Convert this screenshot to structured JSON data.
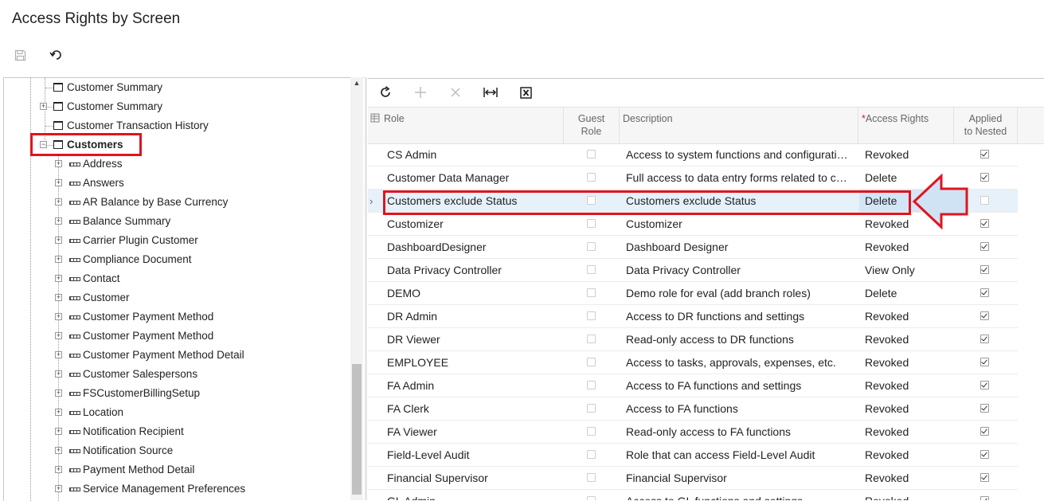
{
  "page": {
    "title": "Access Rights by Screen"
  },
  "toolbar": {
    "save_icon": "save-icon",
    "undo_icon": "undo-icon"
  },
  "tree": {
    "items": [
      {
        "label": "Customer Summary",
        "type": "screen",
        "expandable": false
      },
      {
        "label": "Customer Summary",
        "type": "screen",
        "expandable": true
      },
      {
        "label": "Customer Transaction History",
        "type": "screen",
        "expandable": false
      },
      {
        "label": "Customers",
        "type": "screen",
        "expandable": true,
        "expanded": true,
        "highlighted": true
      },
      {
        "label": "Address",
        "type": "container"
      },
      {
        "label": "Answers",
        "type": "container"
      },
      {
        "label": "AR Balance by Base Currency",
        "type": "container"
      },
      {
        "label": "Balance Summary",
        "type": "container"
      },
      {
        "label": "Carrier Plugin Customer",
        "type": "container"
      },
      {
        "label": "Compliance Document",
        "type": "container"
      },
      {
        "label": "Contact",
        "type": "container"
      },
      {
        "label": "Customer",
        "type": "container"
      },
      {
        "label": "Customer Payment Method",
        "type": "container"
      },
      {
        "label": "Customer Payment Method",
        "type": "container"
      },
      {
        "label": "Customer Payment Method Detail",
        "type": "container"
      },
      {
        "label": "Customer Salespersons",
        "type": "container"
      },
      {
        "label": "FSCustomerBillingSetup",
        "type": "container"
      },
      {
        "label": "Location",
        "type": "container"
      },
      {
        "label": "Notification Recipient",
        "type": "container"
      },
      {
        "label": "Notification Source",
        "type": "container"
      },
      {
        "label": "Payment Method Detail",
        "type": "container"
      },
      {
        "label": "Service Management Preferences",
        "type": "container"
      }
    ]
  },
  "grid": {
    "toolbar": [
      "refresh-icon",
      "add-icon",
      "delete-icon",
      "fit-width-icon",
      "export-excel-icon"
    ],
    "columns": {
      "role": "Role",
      "guest_role_1": "Guest",
      "guest_role_2": "Role",
      "description": "Description",
      "required_mark": "*",
      "access_rights": "Access Rights",
      "applied_1": "Applied",
      "applied_2": "to Nested"
    },
    "rows": [
      {
        "role": "CS Admin",
        "guest": false,
        "description": "Access to system functions and configuration i...",
        "rights": "Revoked",
        "applied": true
      },
      {
        "role": "Customer Data Manager",
        "guest": false,
        "description": "Full access to data entry forms related to custo...",
        "rights": "Delete",
        "applied": true
      },
      {
        "role": "Customers exclude Status",
        "guest": false,
        "description": "Customers exclude Status",
        "rights": "Delete",
        "applied": false,
        "selected": true
      },
      {
        "role": "Customizer",
        "guest": false,
        "description": "Customizer",
        "rights": "Revoked",
        "applied": true
      },
      {
        "role": "DashboardDesigner",
        "guest": false,
        "description": "Dashboard Designer",
        "rights": "Revoked",
        "applied": true
      },
      {
        "role": "Data Privacy Controller",
        "guest": false,
        "description": "Data Privacy Controller",
        "rights": "View Only",
        "applied": true
      },
      {
        "role": "DEMO",
        "guest": false,
        "description": "Demo role for eval (add branch roles)",
        "rights": "Delete",
        "applied": true
      },
      {
        "role": "DR Admin",
        "guest": false,
        "description": "Access to DR functions and settings",
        "rights": "Revoked",
        "applied": true
      },
      {
        "role": "DR Viewer",
        "guest": false,
        "description": "Read-only access to DR functions",
        "rights": "Revoked",
        "applied": true
      },
      {
        "role": "EMPLOYEE",
        "guest": false,
        "description": "Access to tasks, approvals, expenses, etc.",
        "rights": "Revoked",
        "applied": true
      },
      {
        "role": "FA Admin",
        "guest": false,
        "description": "Access to FA functions and settings",
        "rights": "Revoked",
        "applied": true
      },
      {
        "role": "FA Clerk",
        "guest": false,
        "description": "Access to FA functions",
        "rights": "Revoked",
        "applied": true
      },
      {
        "role": "FA Viewer",
        "guest": false,
        "description": "Read-only access to FA functions",
        "rights": "Revoked",
        "applied": true
      },
      {
        "role": "Field-Level Audit",
        "guest": false,
        "description": "Role that can access Field-Level Audit",
        "rights": "Revoked",
        "applied": true
      },
      {
        "role": "Financial Supervisor",
        "guest": false,
        "description": "Financial Supervisor",
        "rights": "Revoked",
        "applied": true
      },
      {
        "role": "GL Admin",
        "guest": false,
        "description": "Access to GL functions and settings",
        "rights": "Revoked",
        "applied": true
      }
    ]
  },
  "colors": {
    "highlight": "#e0141e",
    "selected_row": "#e7f1fa",
    "arrow_fill": "#cfe3f5"
  }
}
